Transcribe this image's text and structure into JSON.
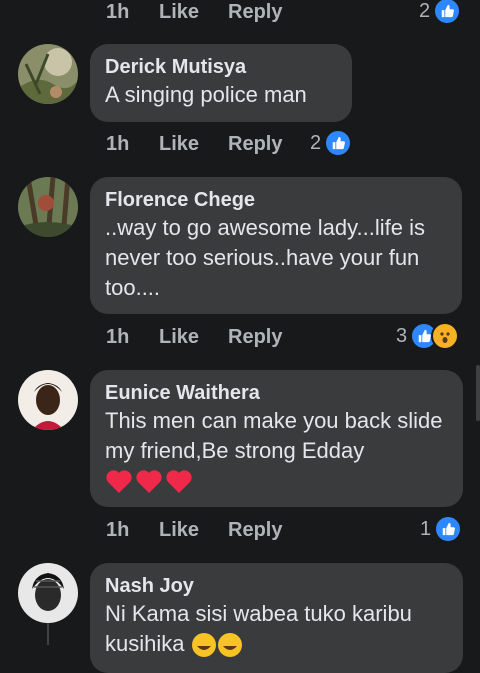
{
  "top_row": {
    "time": "1h",
    "like": "Like",
    "reply": "Reply",
    "reactions": "2"
  },
  "comments": [
    {
      "name": "Derick Mutisya",
      "text": "A singing police man",
      "time": "1h",
      "like": "Like",
      "reply": "Reply",
      "reactions": "2"
    },
    {
      "name": "Florence Chege",
      "text": "..way to go awesome lady...life is never too serious..have your fun too....",
      "time": "1h",
      "like": "Like",
      "reply": "Reply",
      "reactions": "3"
    },
    {
      "name": "Eunice Waithera",
      "text": "This men can make you back slide my friend,Be strong Edday",
      "emoji": [
        "❤",
        "❤",
        "❤"
      ],
      "time": "1h",
      "like": "Like",
      "reply": "Reply",
      "reactions": "1"
    },
    {
      "name": "Nash Joy",
      "text": "Ni Kama sisi wabea tuko karibu kusihika"
    }
  ],
  "icons": {
    "like": "like-icon",
    "wow": "wow-icon",
    "heart": "heart-emoji",
    "laugh": "laughing-emoji"
  },
  "colors": {
    "background": "#18191a",
    "bubble": "#3a3b3c",
    "like_blue": "#2d88ff",
    "heart_red": "#f02849"
  }
}
